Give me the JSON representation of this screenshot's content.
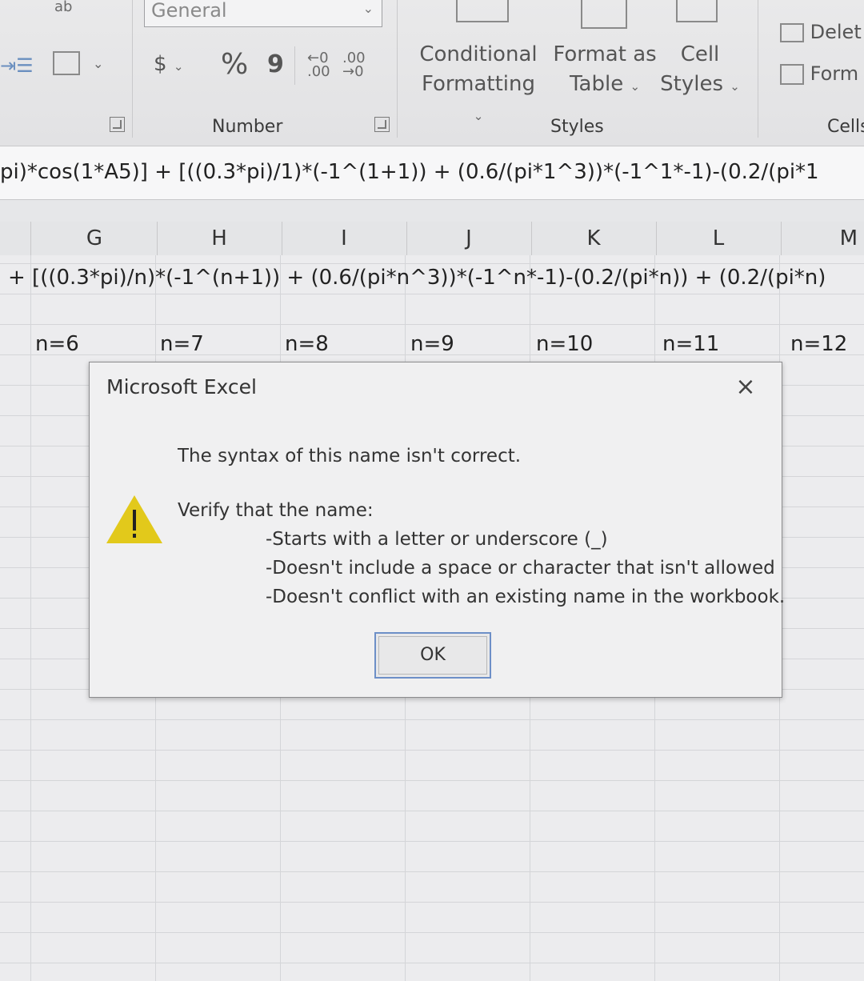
{
  "ribbon": {
    "number_format_value": "General",
    "currency_symbol": "$",
    "percent_symbol": "%",
    "comma_symbol": "9",
    "increase_decimal_label": "←0 .00",
    "decrease_decimal_label": ".00 →0",
    "conditional_formatting": [
      "Conditional",
      "Formatting"
    ],
    "format_as_table": [
      "Format as",
      "Table"
    ],
    "cell_styles": [
      "Cell",
      "Styles"
    ],
    "delete_label": "Delet",
    "format_label": "Form",
    "groups": {
      "number": "Number",
      "styles": "Styles",
      "cells": "Cells"
    }
  },
  "formula_bar": {
    "text": "pi)*cos(1*A5)] + [((0.3*pi)/1)*(-1^(1+1)) + (0.6/(pi*1^3))*(-1^1*-1)-(0.2/(pi*1"
  },
  "columns": [
    "G",
    "H",
    "I",
    "J",
    "K",
    "L",
    "M"
  ],
  "sheet": {
    "row_formula": "+ [((0.3*pi)/n)*(-1^(n+1)) + (0.6/(pi*n^3))*(-1^n*-1)-(0.2/(pi*n)) + (0.2/(pi*n)",
    "n_labels": [
      "n=6",
      "n=7",
      "n=8",
      "n=9",
      "n=10",
      "n=11",
      "n=12"
    ]
  },
  "dialog": {
    "title": "Microsoft Excel",
    "close_symbol": "×",
    "message": "The syntax of this name isn't correct.",
    "verify_heading": "Verify that the name:",
    "rules": [
      "-Starts with a letter or underscore (_)",
      "-Doesn't include a space or character that isn't allowed",
      "-Doesn't conflict with an existing name in the workbook."
    ],
    "ok_label": "OK",
    "warning_color": "#e2c91b"
  }
}
